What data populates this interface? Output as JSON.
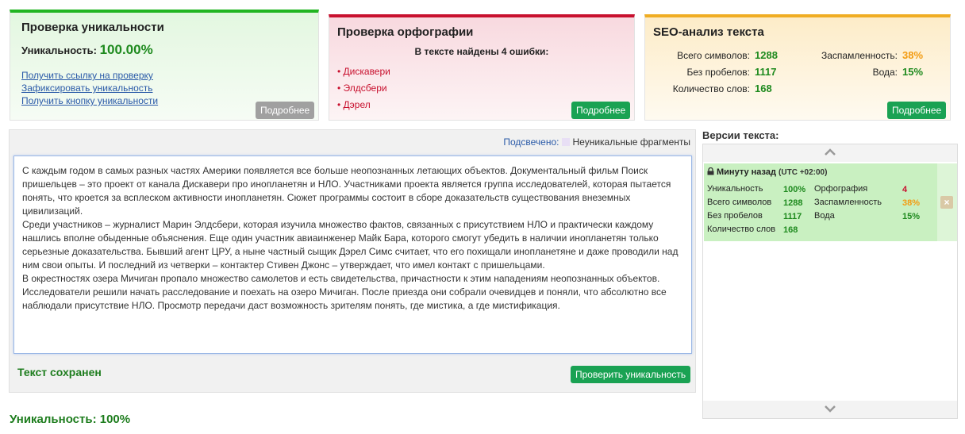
{
  "uniqueness_panel": {
    "title": "Проверка уникальности",
    "label": "Уникальность:",
    "value": "100.00%",
    "links": [
      "Получить ссылку на проверку",
      "Зафиксировать уникальность",
      "Получить кнопку уникальности"
    ],
    "more_button": "Подробнее"
  },
  "spelling_panel": {
    "title": "Проверка орфографии",
    "summary": "В тексте найдены 4 ошибки:",
    "errors": [
      "Дискавери",
      "Элдсбери",
      "Дэрел"
    ],
    "more_button": "Подробнее"
  },
  "seo_panel": {
    "title": "SEO-анализ текста",
    "total_chars_label": "Всего символов:",
    "total_chars": "1288",
    "no_spaces_label": "Без пробелов:",
    "no_spaces": "1117",
    "word_count_label": "Количество слов:",
    "word_count": "168",
    "spam_label": "Заспамленность:",
    "spam": "38%",
    "water_label": "Вода:",
    "water": "15%",
    "more_button": "Подробнее"
  },
  "editor": {
    "highlight_label": "Подсвечено:",
    "highlight_legend": "Неуникальные фрагменты",
    "paragraphs": [
      "С каждым годом в самых разных частях Америки появляется все больше неопознанных летающих объектов. Документальный фильм Поиск пришельцев – это проект от канала Дискавери про инопланетян и НЛО. Участниками проекта является группа исследователей, которая пытается понять, что кроется за всплеском активности инопланетян. Сюжет программы состоит в сборе доказательств существования внеземных цивилизаций.",
      "Среди участников – журналист Марин Элдсбери, которая изучила множество фактов, связанных с присутствием НЛО и практически каждому нашлись вполне обыденные объяснения. Еще один участник авиаинженер Майк Бара, которого смогут убедить в наличии инопланетян только серьезные доказательства. Бывший агент ЦРУ, а ныне частный сыщик Дэрел Симс считает, что его похищали инопланетяне и даже проводили над ним свои опыты. И последний из четверки – контактер Стивен Джонс – утверждает, что имел контакт с пришельцами.",
      "В окрестностях озера Мичиган пропало множество самолетов и есть свидетельства, причастности к этим нападениям неопознанных объектов. Исследователи решили начать расследование и поехать на озеро Мичиган. После приезда они собрали очевидцев и поняли, что абсолютно все наблюдали присутствие НЛО. Просмотр передачи даст возможность зрителям понять, где мистика, а где мистификация."
    ],
    "saved_label": "Текст сохранен",
    "check_button": "Проверить уникальность"
  },
  "bottom_uniqueness": "Уникальность: 100%",
  "versions": {
    "title": "Версии текста:",
    "items": [
      {
        "time": "Минуту назад",
        "timezone": "(UTC +02:00)",
        "uniq_label": "Уникальность",
        "uniq": "100%",
        "total_label": "Всего символов",
        "total": "1288",
        "nospace_label": "Без пробелов",
        "nospace": "1117",
        "words_label": "Количество слов",
        "words": "168",
        "spelling_label": "Орфография",
        "spelling": "4",
        "spam_label": "Заспамленность",
        "spam": "38%",
        "water_label": "Вода",
        "water": "15%"
      }
    ]
  },
  "colors": {
    "green": "#1aa253",
    "red": "#c8102e",
    "orange": "#f39c12"
  }
}
